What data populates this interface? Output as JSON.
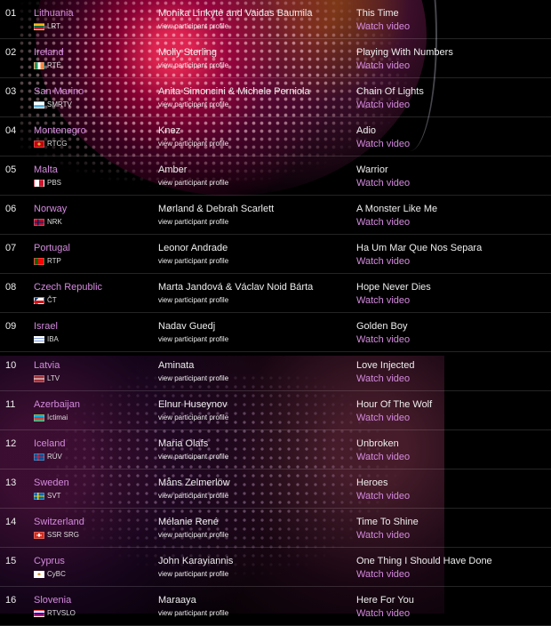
{
  "colors": {
    "accent": "#d48adf",
    "text": "#eeeeee",
    "background": "#000000"
  },
  "rows": [
    {
      "num": "01",
      "country": "Lithuania",
      "broadcaster": "LRT",
      "flag": "flag-lithuania-icon",
      "flag_bg": "linear-gradient(#fdb913 0 33%,#006a44 33% 66%,#c1272d 66%)",
      "artist": "Monika Linkytė and Vaidas Baumila",
      "profile_link": "view participant profile",
      "song": "This Time",
      "video_link": "Watch video"
    },
    {
      "num": "02",
      "country": "Ireland",
      "broadcaster": "RTÉ",
      "flag": "flag-ireland-icon",
      "flag_bg": "linear-gradient(90deg,#169b62 0 33%,#ffffff 33% 66%,#ff883e 66%)",
      "artist": "Molly Sterling",
      "profile_link": "view participant profile",
      "song": "Playing With Numbers",
      "video_link": "Watch video"
    },
    {
      "num": "03",
      "country": "San Marino",
      "broadcaster": "SMRTV",
      "flag": "flag-san-marino-icon",
      "flag_bg": "linear-gradient(#ffffff 0 50%,#5eb6e4 50%)",
      "artist": "Anita Simoncini & Michele Perniola",
      "profile_link": "view participant profile",
      "song": "Chain Of Lights",
      "video_link": "Watch video"
    },
    {
      "num": "04",
      "country": "Montenegro",
      "broadcaster": "RTCG",
      "flag": "flag-montenegro-icon",
      "flag_bg": "radial-gradient(circle,#d4af37 0 25%,#c40308 27%)",
      "artist": "Knez",
      "profile_link": "view participant profile",
      "song": "Adio",
      "video_link": "Watch video"
    },
    {
      "num": "05",
      "country": "Malta",
      "broadcaster": "PBS",
      "flag": "flag-malta-icon",
      "flag_bg": "linear-gradient(90deg,#ffffff 0 50%,#cf142b 50%)",
      "artist": "Amber",
      "profile_link": "view participant profile",
      "song": "Warrior",
      "video_link": "Watch video"
    },
    {
      "num": "06",
      "country": "Norway",
      "broadcaster": "NRK",
      "flag": "flag-norway-icon",
      "flag_bg": "linear-gradient(90deg,transparent 0 30%,#00205b 30% 44%,transparent 44%),linear-gradient(transparent 0 40%,#00205b 40% 60%,transparent 60%),#ba0c2f",
      "artist": "Mørland & Debrah Scarlett",
      "profile_link": "view participant profile",
      "song": "A Monster Like Me",
      "video_link": "Watch video"
    },
    {
      "num": "07",
      "country": "Portugal",
      "broadcaster": "RTP",
      "flag": "flag-portugal-icon",
      "flag_bg": "linear-gradient(90deg,#006600 0 40%,#ff0000 40%)",
      "artist": "Leonor Andrade",
      "profile_link": "view participant profile",
      "song": "Ha Um Mar Que Nos Separa",
      "video_link": "Watch video"
    },
    {
      "num": "08",
      "country": "Czech Republic",
      "broadcaster": "ČT",
      "flag": "flag-czech-republic-icon",
      "flag_bg": "linear-gradient(135deg,#11457e 0 25%,transparent 25%),linear-gradient(#ffffff 0 50%,#d7141a 50%)",
      "artist": "Marta Jandová & Václav Noid Bárta",
      "profile_link": "view participant profile",
      "song": "Hope Never Dies",
      "video_link": "Watch video"
    },
    {
      "num": "09",
      "country": "Israel",
      "broadcaster": "IBA",
      "flag": "flag-israel-icon",
      "flag_bg": "linear-gradient(#ffffff 0 15%,#0038b8 15% 28%,#ffffff 28% 72%,#0038b8 72% 85%,#ffffff 85%)",
      "artist": "Nadav Guedj",
      "profile_link": "view participant profile",
      "song": "Golden Boy",
      "video_link": "Watch video"
    },
    {
      "num": "10",
      "country": "Latvia",
      "broadcaster": "LTV",
      "flag": "flag-latvia-icon",
      "flag_bg": "linear-gradient(#9e3039 0 40%,#ffffff 40% 60%,#9e3039 60%)",
      "artist": "Aminata",
      "profile_link": "view participant profile",
      "song": "Love Injected",
      "video_link": "Watch video"
    },
    {
      "num": "11",
      "country": "Azerbaijan",
      "broadcaster": "İctimai",
      "flag": "flag-azerbaijan-icon",
      "flag_bg": "linear-gradient(#00b5e2 0 33%,#ef3340 33% 66%,#509e2f 66%)",
      "artist": "Elnur Huseynov",
      "profile_link": "view participant profile",
      "song": "Hour Of The Wolf",
      "video_link": "Watch video"
    },
    {
      "num": "12",
      "country": "Iceland",
      "broadcaster": "RÚV",
      "flag": "flag-iceland-icon",
      "flag_bg": "linear-gradient(90deg,transparent 0 30%,#dc1e35 30% 44%,transparent 44%),linear-gradient(transparent 0 40%,#dc1e35 40% 60%,transparent 60%),#02529c",
      "artist": "Maria Olafs",
      "profile_link": "view participant profile",
      "song": "Unbroken",
      "video_link": "Watch video"
    },
    {
      "num": "13",
      "country": "Sweden",
      "broadcaster": "SVT",
      "flag": "flag-sweden-icon",
      "flag_bg": "linear-gradient(90deg,transparent 0 30%,#fecc02 30% 44%,transparent 44%),linear-gradient(transparent 0 40%,#fecc02 40% 60%,transparent 60%),#006aa7",
      "artist": "Måns Zelmerlöw",
      "profile_link": "view participant profile",
      "song": "Heroes",
      "video_link": "Watch video"
    },
    {
      "num": "14",
      "country": "Switzerland",
      "broadcaster": "SSR SRG",
      "flag": "flag-switzerland-icon",
      "flag_bg": "linear-gradient(90deg,transparent 0 40%,#ffffff 40% 60%,transparent 60%) center/100% 60% no-repeat,linear-gradient(transparent 0 40%,#ffffff 40% 60%,transparent 60%) center/60% 100% no-repeat,#d52b1e",
      "artist": "Mélanie René",
      "profile_link": "view participant profile",
      "song": "Time To Shine",
      "video_link": "Watch video"
    },
    {
      "num": "15",
      "country": "Cyprus",
      "broadcaster": "CyBC",
      "flag": "flag-cyprus-icon",
      "flag_bg": "radial-gradient(ellipse at 50% 45%,#d57800 0 22%,#ffffff 24%)",
      "artist": "John Karayiannis",
      "profile_link": "view participant profile",
      "song": "One Thing I Should Have Done",
      "video_link": "Watch video"
    },
    {
      "num": "16",
      "country": "Slovenia",
      "broadcaster": "RTVSLO",
      "flag": "flag-slovenia-icon",
      "flag_bg": "linear-gradient(#ffffff 0 33%,#0000ff 33% 66%,#ff0000 66%)",
      "artist": "Maraaya",
      "profile_link": "view participant profile",
      "song": "Here For You",
      "video_link": "Watch video"
    }
  ]
}
